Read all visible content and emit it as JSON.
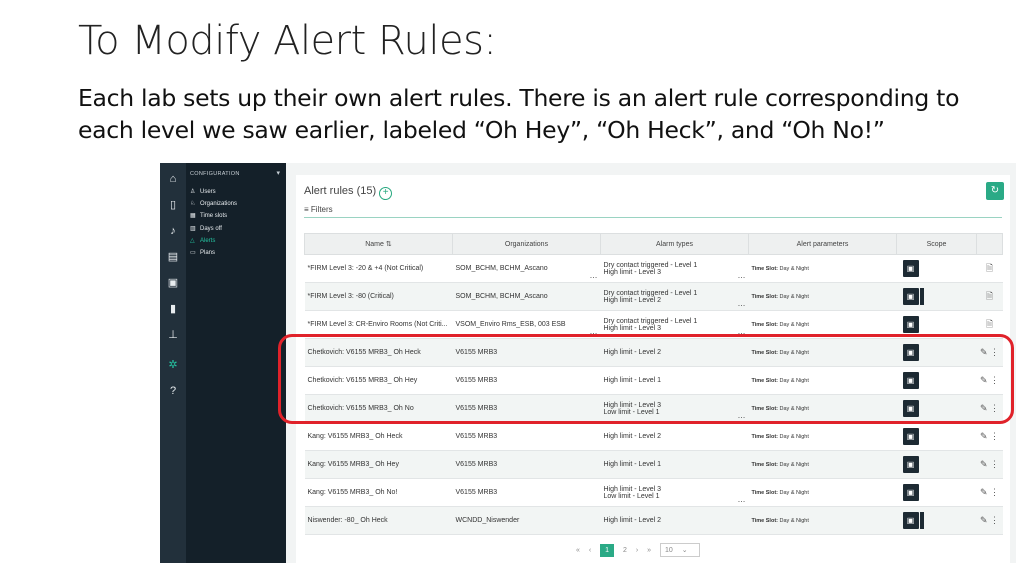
{
  "slide": {
    "title": "To Modify Alert Rules:",
    "body": "Each lab sets up their own alert rules. There is an alert rule corresponding to each level we saw earlier, labeled “Oh Hey”, “Oh Heck”, and “Oh No!”"
  },
  "app": {
    "icon_bar": [
      "home-icon",
      "device-icon",
      "bell-icon",
      "document-icon",
      "sensor-icon",
      "thermometer-icon",
      "shelf-icon",
      "gear-icon",
      "help-icon"
    ],
    "sidebar": {
      "header": "CONFIGURATION",
      "items": [
        {
          "icon": "user-icon",
          "label": "Users"
        },
        {
          "icon": "org-icon",
          "label": "Organizations"
        },
        {
          "icon": "calendar-icon",
          "label": "Time slots"
        },
        {
          "icon": "calendar-off-icon",
          "label": "Days off"
        },
        {
          "icon": "bell-icon",
          "label": "Alerts",
          "active": true
        },
        {
          "icon": "map-icon",
          "label": "Plans"
        }
      ]
    },
    "page": {
      "title": "Alert rules (15)",
      "filters_label": "Filters",
      "columns": [
        "Name",
        "Organizations",
        "Alarm types",
        "Alert parameters",
        "Scope"
      ],
      "rows": [
        {
          "name": "*FIRM Level 3: -20 & +4 (Not Critical)",
          "org": "SOM_BCHM, BCHM_Ascano",
          "org_more": true,
          "alarm1": "Dry contact triggered - Level 1",
          "alarm2": "High limit - Level 3",
          "alarm_more": true,
          "param_key": "Time Slot:",
          "param_val": "Day & Night",
          "scope": "single",
          "action": "view"
        },
        {
          "name": "*FIRM Level 3: -80 (Critical)",
          "org": "SOM_BCHM, BCHM_Ascano",
          "org_more": false,
          "alarm1": "Dry contact triggered - Level 1",
          "alarm2": "High limit - Level 2",
          "alarm_more": true,
          "param_key": "Time Slot:",
          "param_val": "Day & Night",
          "scope": "double",
          "action": "view"
        },
        {
          "name": "*FIRM Level 3: CR-Enviro Rooms (Not Criti...",
          "org": "VSOM_Enviro Rms_ESB, 003 ESB",
          "org_more": true,
          "alarm1": "Dry contact triggered - Level 1",
          "alarm2": "High limit - Level 3",
          "alarm_more": true,
          "param_key": "Time Slot:",
          "param_val": "Day & Night",
          "scope": "single",
          "action": "view"
        },
        {
          "name": "Chetkovich: V6155 MRB3_ Oh Heck",
          "org": "V6155 MRB3",
          "org_more": false,
          "alarm1": "High limit - Level 2",
          "alarm2": "",
          "alarm_more": false,
          "param_key": "Time Slot:",
          "param_val": "Day & Night",
          "scope": "single",
          "action": "edit"
        },
        {
          "name": "Chetkovich: V6155 MRB3_ Oh Hey",
          "org": "V6155 MRB3",
          "org_more": false,
          "alarm1": "High limit - Level 1",
          "alarm2": "",
          "alarm_more": false,
          "param_key": "Time Slot:",
          "param_val": "Day & Night",
          "scope": "single",
          "action": "edit"
        },
        {
          "name": "Chetkovich: V6155 MRB3_ Oh No",
          "org": "V6155 MRB3",
          "org_more": false,
          "alarm1": "High limit - Level 3",
          "alarm2": "Low limit - Level 1",
          "alarm_more": true,
          "param_key": "Time Slot:",
          "param_val": "Day & Night",
          "scope": "single",
          "action": "edit"
        },
        {
          "name": "Kang: V6155 MRB3_ Oh Heck",
          "org": "V6155 MRB3",
          "org_more": false,
          "alarm1": "High limit - Level 2",
          "alarm2": "",
          "alarm_more": false,
          "param_key": "Time Slot:",
          "param_val": "Day & Night",
          "scope": "single",
          "action": "edit"
        },
        {
          "name": "Kang: V6155 MRB3_ Oh Hey",
          "org": "V6155 MRB3",
          "org_more": false,
          "alarm1": "High limit - Level 1",
          "alarm2": "",
          "alarm_more": false,
          "param_key": "Time Slot:",
          "param_val": "Day & Night",
          "scope": "single",
          "action": "edit"
        },
        {
          "name": "Kang: V6155 MRB3_ Oh No!",
          "org": "V6155 MRB3",
          "org_more": false,
          "alarm1": "High limit - Level 3",
          "alarm2": "Low limit - Level 1",
          "alarm_more": true,
          "param_key": "Time Slot:",
          "param_val": "Day & Night",
          "scope": "single",
          "action": "edit"
        },
        {
          "name": "Niswender: -80_ Oh Heck",
          "org": "WCNDD_Niswender",
          "org_more": false,
          "alarm1": "High limit - Level 2",
          "alarm2": "",
          "alarm_more": false,
          "param_key": "Time Slot:",
          "param_val": "Day & Night",
          "scope": "double",
          "action": "edit"
        }
      ],
      "pagination": {
        "first": "«",
        "prev": "‹",
        "current": "1",
        "page2": "2",
        "next": "›",
        "last": "»",
        "page_size": "10"
      }
    }
  },
  "colors": {
    "accent": "#2aaa86",
    "sidebar": "#142029",
    "highlight": "#e0222a"
  }
}
